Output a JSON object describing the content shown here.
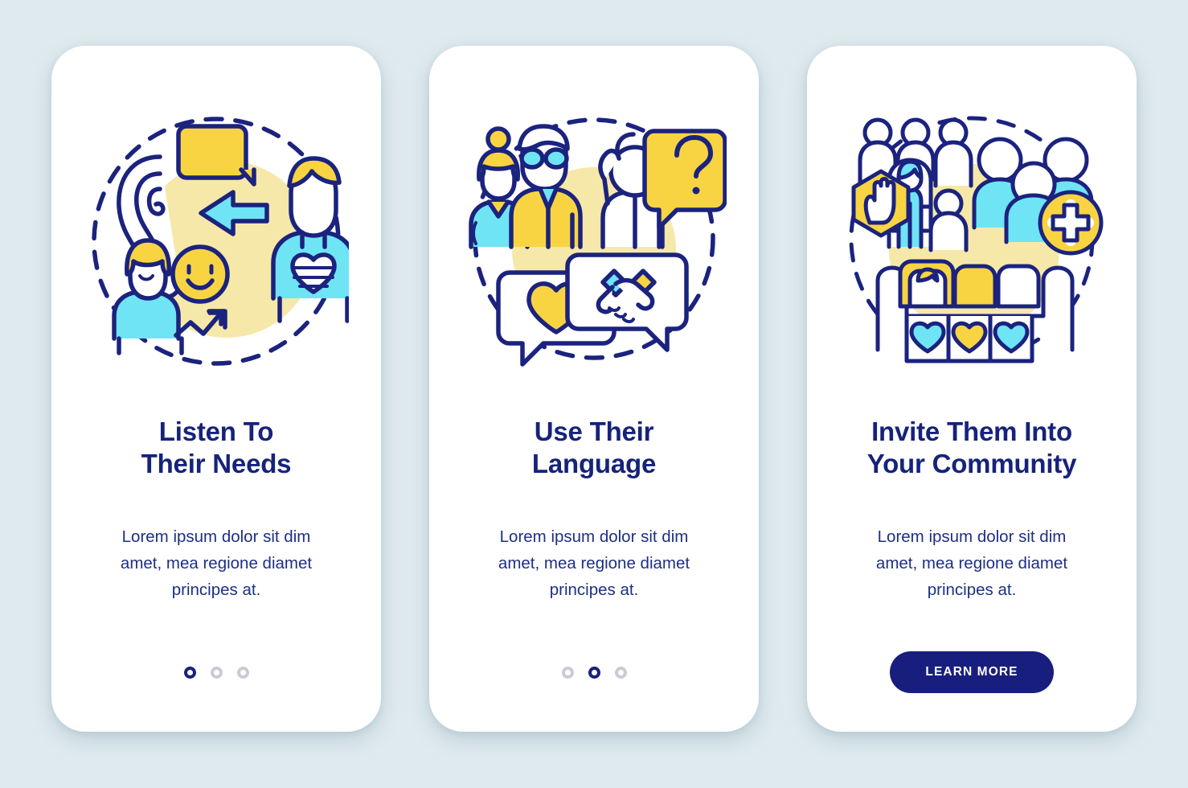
{
  "theme": {
    "page_background": "#dfeaef",
    "card_background": "#ffffff",
    "navy": "#16237a",
    "outline_navy": "#1b237e",
    "yellow": "#f8d442",
    "pale_yellow": "#f6e8a8",
    "cyan": "#6fe4f5",
    "dot_inactive": "#c8ccd4",
    "button_background": "#181e7e",
    "button_text": "#ffffff"
  },
  "screens": [
    {
      "id": "screen-listen",
      "illustration": "listen-to-needs-illustration",
      "illustration_elements": [
        "ear-icon",
        "speech-bubble-icon",
        "left-arrow-icon",
        "woman-avatar-icon",
        "smiley-face-icon",
        "growth-arrow-icon",
        "man-avatar-icon",
        "striped-heart-icon",
        "dashed-circle"
      ],
      "title": "Listen To\nTheir Needs",
      "title_line1": "Listen To",
      "title_line2": "Their Needs",
      "body": "Lorem ipsum dolor sit dim amet, mea regione diamet principes at.",
      "body_line1": "Lorem ipsum dolor sit dim",
      "body_line2": "amet, mea regione diamet",
      "body_line3": "principes at.",
      "footer_type": "dots",
      "dots": {
        "count": 3,
        "active_index": 0
      }
    },
    {
      "id": "screen-language",
      "illustration": "use-their-language-illustration",
      "illustration_elements": [
        "woman-avatar-icon",
        "elderly-man-glasses-icon",
        "confused-person-icon",
        "question-mark-bubble-icon",
        "heart-bubble-icon",
        "handshake-bubble-icon",
        "dashed-circle"
      ],
      "title": "Use Their\nLanguage",
      "title_line1": "Use Their",
      "title_line2": "Language",
      "body": "Lorem ipsum dolor sit dim amet, mea regione diamet principes at.",
      "body_line1": "Lorem ipsum dolor sit dim",
      "body_line2": "amet, mea regione diamet",
      "body_line3": "principes at.",
      "footer_type": "dots",
      "dots": {
        "count": 3,
        "active_index": 1
      }
    },
    {
      "id": "screen-community",
      "illustration": "invite-into-community-illustration",
      "illustration_elements": [
        "crowd-outline-icon",
        "stop-hand-hexagon-icon",
        "excluded-person-icon",
        "group-of-people-icon",
        "add-person-plus-icon",
        "table-seats-icon",
        "heart-icon",
        "dashed-circle"
      ],
      "title": "Invite Them Into\nYour Community",
      "title_line1": "Invite Them Into",
      "title_line2": "Your Community",
      "body": "Lorem ipsum dolor sit dim amet, mea regione diamet principes at.",
      "body_line1": "Lorem ipsum dolor sit dim",
      "body_line2": "amet, mea regione diamet",
      "body_line3": "principes at.",
      "footer_type": "button",
      "button_label": "LEARN MORE"
    }
  ]
}
